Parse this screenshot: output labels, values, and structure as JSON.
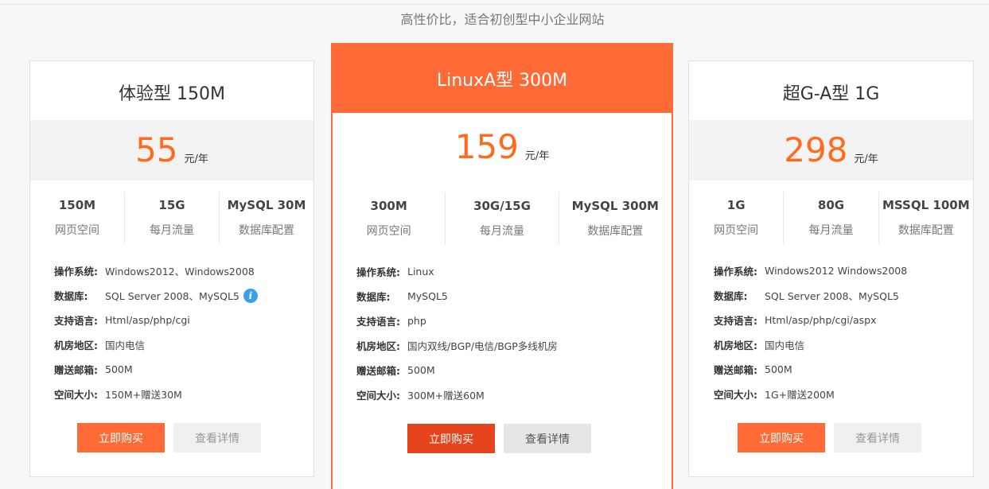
{
  "subtitle": "高性价比，适合初创型中小企业网站",
  "plans": [
    {
      "name": "体验型 150M",
      "price": "55",
      "unit": "元/年",
      "specs": [
        {
          "value": "150M",
          "label": "网页空间"
        },
        {
          "value": "15G",
          "label": "每月流量"
        },
        {
          "value": "MySQL 30M",
          "label": "数据库配置"
        }
      ],
      "details": [
        {
          "key": "操作系统:",
          "value": "Windows2012、Windows2008"
        },
        {
          "key": "数据库:",
          "value": "SQL Server 2008、MySQL5"
        },
        {
          "key": "支持语言:",
          "value": "Html/asp/php/cgi"
        },
        {
          "key": "机房地区:",
          "value": "国内电信"
        },
        {
          "key": "赠送邮箱:",
          "value": "500M"
        },
        {
          "key": "空间大小:",
          "value": "150M+赠送30M"
        }
      ],
      "buy_label": "立即购买",
      "detail_label": "查看详情",
      "info_icon": "i"
    },
    {
      "name": "LinuxA型 300M",
      "price": "159",
      "unit": "元/年",
      "specs": [
        {
          "value": "300M",
          "label": "网页空间"
        },
        {
          "value": "30G/15G",
          "label": "每月流量"
        },
        {
          "value": "MySQL 300M",
          "label": "数据库配置"
        }
      ],
      "details": [
        {
          "key": "操作系统:",
          "value": "Linux"
        },
        {
          "key": "数据库:",
          "value": "MySQL5"
        },
        {
          "key": "支持语言:",
          "value": "php"
        },
        {
          "key": "机房地区:",
          "value": "国内双线/BGP/电信/BGP多线机房"
        },
        {
          "key": "赠送邮箱:",
          "value": "500M"
        },
        {
          "key": "空间大小:",
          "value": "300M+赠送60M"
        }
      ],
      "buy_label": "立即购买",
      "detail_label": "查看详情"
    },
    {
      "name": "超G-A型 1G",
      "price": "298",
      "unit": "元/年",
      "specs": [
        {
          "value": "1G",
          "label": "网页空间"
        },
        {
          "value": "80G",
          "label": "每月流量"
        },
        {
          "value": "MSSQL 100M",
          "label": "数据库配置"
        }
      ],
      "details": [
        {
          "key": "操作系统:",
          "value": "Windows2012 Windows2008"
        },
        {
          "key": "数据库:",
          "value": "SQL Server 2008、MySQL5"
        },
        {
          "key": "支持语言:",
          "value": "Html/asp/php/cgi/aspx"
        },
        {
          "key": "机房地区:",
          "value": "国内电信"
        },
        {
          "key": "赠送邮箱:",
          "value": "500M"
        },
        {
          "key": "空间大小:",
          "value": "1G+赠送200M"
        }
      ],
      "buy_label": "立即购买",
      "detail_label": "查看详情"
    }
  ]
}
